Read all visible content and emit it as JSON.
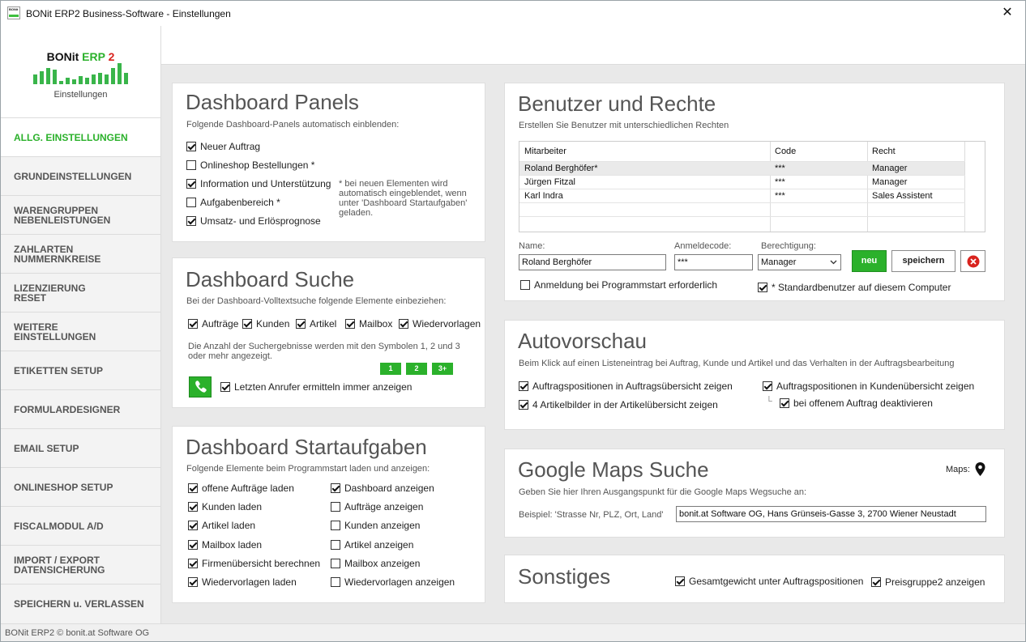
{
  "window": {
    "title": "BONit ERP2 Business-Software - Einstellungen",
    "close": "✕",
    "logo_text": "BONit ERP2"
  },
  "sidebar": {
    "logo": {
      "brand": "BONit",
      "erp": "ERP",
      "num": "2",
      "subtitle": "Einstellungen"
    },
    "items": [
      {
        "label": "ALLG. EINSTELLUNGEN",
        "active": true
      },
      {
        "label": "GRUNDEINSTELLUNGEN"
      },
      {
        "label": "WARENGRUPPEN\nNEBENLEISTUNGEN"
      },
      {
        "label": "ZAHLARTEN\nNUMMERNKREISE"
      },
      {
        "label": "LIZENZIERUNG\nRESET"
      },
      {
        "label": "WEITERE\nEINSTELLUNGEN"
      },
      {
        "label": "ETIKETTEN SETUP"
      },
      {
        "label": "FORMULARDESIGNER"
      },
      {
        "label": "EMAIL SETUP"
      },
      {
        "label": "ONLINESHOP SETUP"
      },
      {
        "label": "FISCALMODUL A/D"
      },
      {
        "label": "IMPORT / EXPORT\nDATENSICHERUNG"
      },
      {
        "label": "SPEICHERN u. VERLASSEN"
      }
    ]
  },
  "status": {
    "text": "BONit ERP2 © bonit.at Software OG"
  },
  "dashboard_panels": {
    "title": "Dashboard Panels",
    "subtitle": "Folgende Dashboard-Panels automatisch einblenden:",
    "options": [
      {
        "label": "Neuer Auftrag",
        "checked": true
      },
      {
        "label": "Onlineshop Bestellungen *",
        "checked": false
      },
      {
        "label": "Information und Unterstützung",
        "checked": true
      },
      {
        "label": "Aufgabenbereich *",
        "checked": false
      },
      {
        "label": "Umsatz- und Erlösprognose",
        "checked": true
      }
    ],
    "note": "* bei neuen Elementen wird automatisch eingeblendet, wenn unter 'Dashboard Startaufgaben' geladen."
  },
  "dashboard_suche": {
    "title": "Dashboard Suche",
    "subtitle": "Bei der Dashboard-Volltextsuche folgende Elemente einbeziehen:",
    "options": [
      {
        "label": "Aufträge",
        "checked": true
      },
      {
        "label": "Kunden",
        "checked": true
      },
      {
        "label": "Artikel",
        "checked": true
      },
      {
        "label": "Mailbox",
        "checked": true
      },
      {
        "label": "Wiedervorlagen",
        "checked": true
      }
    ],
    "note": "Die Anzahl der Suchergebnisse werden mit den Symbolen 1, 2 und 3 oder mehr angezeigt.",
    "badges": [
      "1",
      "2",
      "3+"
    ],
    "caller_option": {
      "label": "Letzten Anrufer ermitteln immer anzeigen",
      "checked": true
    }
  },
  "dashboard_startaufgaben": {
    "title": "Dashboard Startaufgaben",
    "subtitle": "Folgende Elemente beim Programmstart laden und anzeigen:",
    "left": [
      {
        "label": "offene Aufträge laden",
        "checked": true
      },
      {
        "label": "Kunden laden",
        "checked": true
      },
      {
        "label": "Artikel laden",
        "checked": true
      },
      {
        "label": "Mailbox laden",
        "checked": true
      },
      {
        "label": "Firmenübersicht berechnen",
        "checked": true
      },
      {
        "label": "Wiedervorlagen laden",
        "checked": true
      }
    ],
    "right": [
      {
        "label": "Dashboard anzeigen",
        "checked": true
      },
      {
        "label": "Aufträge anzeigen",
        "checked": false
      },
      {
        "label": "Kunden anzeigen",
        "checked": false
      },
      {
        "label": "Artikel anzeigen",
        "checked": false
      },
      {
        "label": "Mailbox anzeigen",
        "checked": false
      },
      {
        "label": "Wiedervorlagen anzeigen",
        "checked": false
      }
    ]
  },
  "benutzer": {
    "title": "Benutzer und Rechte",
    "subtitle": "Erstellen Sie Benutzer mit unterschiedlichen Rechten",
    "columns": [
      "Mitarbeiter",
      "Code",
      "Recht"
    ],
    "rows": [
      [
        "Roland Berghöfer*",
        "***",
        "Manager"
      ],
      [
        "Jürgen Fitzal",
        "***",
        "Manager"
      ],
      [
        "Karl Indra",
        "***",
        "Sales Assistent"
      ]
    ],
    "form": {
      "name_label": "Name:",
      "name_value": "Roland Berghöfer",
      "code_label": "Anmeldecode:",
      "code_value": "***",
      "role_label": "Berechtigung:",
      "role_value": "Manager",
      "new_label": "neu",
      "save_label": "speichern"
    },
    "login_option": {
      "label": "Anmeldung bei Programmstart erforderlich",
      "checked": false
    },
    "default_option": {
      "label": "* Standardbenutzer auf diesem Computer",
      "checked": true
    }
  },
  "autovorschau": {
    "title": "Autovorschau",
    "subtitle": "Beim Klick auf einen Listeneintrag bei Auftrag, Kunde und Artikel und das  Verhalten in der Auftragsbearbeitung",
    "options": [
      {
        "label": "Auftragspositionen in Auftragsübersicht zeigen",
        "checked": true
      },
      {
        "label": "4 Artikelbilder in der Artikelübersicht zeigen",
        "checked": true
      },
      {
        "label": "Auftragspositionen in Kundenübersicht zeigen",
        "checked": true
      },
      {
        "label": "bei offenem Auftrag deaktivieren",
        "checked": true
      }
    ],
    "tree_glyph": "└"
  },
  "maps": {
    "title": "Google Maps Suche",
    "maps_label": "Maps:",
    "subtitle": "Geben Sie hier Ihren Ausgangspunkt für die Google Maps Wegsuche an:",
    "example_label": "Beispiel: 'Strasse Nr, PLZ, Ort, Land'",
    "address": "bonit.at Software OG, Hans Grünseis-Gasse 3, 2700 Wiener Neustadt"
  },
  "sonstiges": {
    "title": "Sonstiges",
    "options": [
      {
        "label": "Gesamtgewicht unter Auftragspositionen",
        "checked": true
      },
      {
        "label": "Preisgruppe2 anzeigen",
        "checked": true
      }
    ]
  },
  "colors": {
    "accent": "#2bb12b",
    "delete": "#d9231e"
  },
  "icons": [
    "close-icon",
    "phone-icon",
    "map-pin-icon",
    "delete-icon",
    "chevron-down-icon",
    "check-icon"
  ]
}
